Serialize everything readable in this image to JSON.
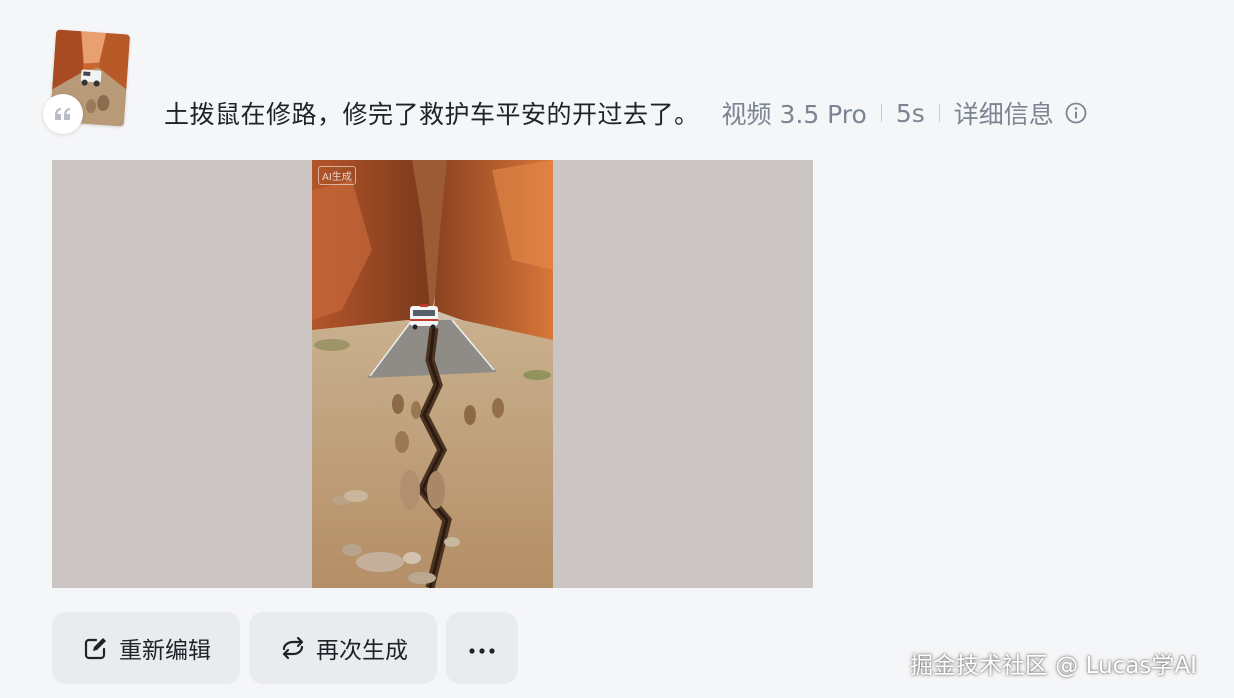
{
  "prompt": {
    "text": "土拨鼠在修路，修完了救护车平安的开过去了。",
    "thumbnail_icon": "canyon-thumbnail-image",
    "quote_icon": "quote-icon"
  },
  "meta": {
    "model": "视频 3.5 Pro",
    "duration": "5s",
    "details_label": "详细信息",
    "info_icon": "info-circle-icon"
  },
  "video": {
    "ai_badge": "AI生成",
    "letterbox_color": "#cbc6c4"
  },
  "actions": {
    "edit_label": "重新编辑",
    "edit_icon": "edit-icon",
    "regen_label": "再次生成",
    "regen_icon": "refresh-icon",
    "more_label": "···",
    "more_icon": "more-icon"
  },
  "footer": {
    "watermark": "掘金技术社区 @ Lucas学AI"
  },
  "colors": {
    "background": "#f5f6f8",
    "text_primary": "#1f2329",
    "text_secondary": "#7b8491",
    "button_bg": "#e9ebee"
  }
}
